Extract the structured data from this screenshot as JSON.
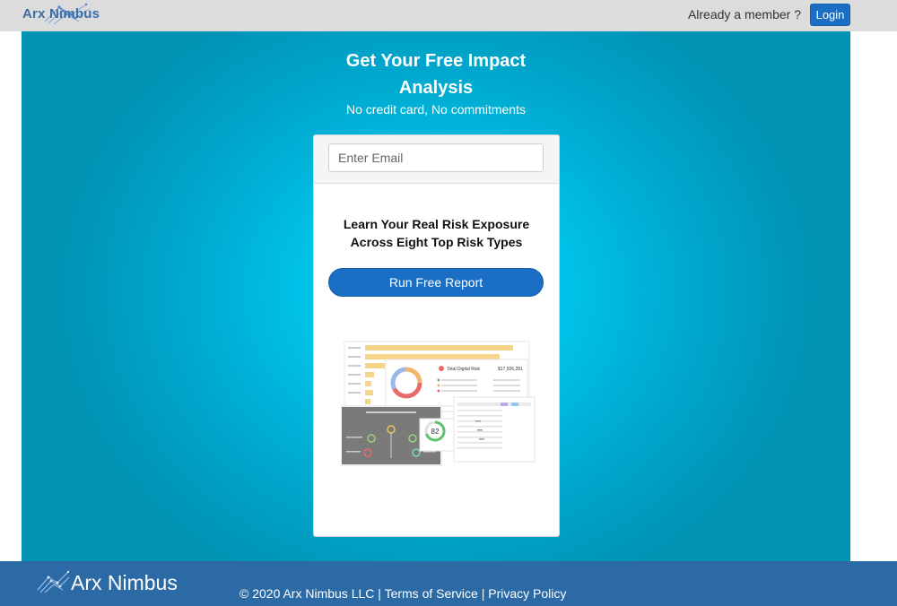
{
  "header": {
    "logo_text": "Arx Nimbus",
    "member_prompt": "Already a member ?",
    "login_label": "Login"
  },
  "hero": {
    "title_line1": "Get Your Free Impact",
    "title_line2": "Analysis",
    "subtitle": "No credit card, No commitments"
  },
  "signup_card": {
    "email_placeholder": "Enter Email",
    "email_value": "",
    "heading_line1": "Learn Your Real Risk Exposure",
    "heading_line2": "Across Eight Top Risk Types",
    "run_button_label": "Run Free Report",
    "preview_total_label": "Total Digital Risk",
    "preview_total_value": "$17,926,281",
    "preview_score": "82"
  },
  "footer": {
    "logo_text": "Arx Nimbus",
    "copyright": "© 2020 Arx Nimbus LLC",
    "separator": " | ",
    "terms_label": "Terms of Service",
    "privacy_label": "Privacy Policy"
  },
  "colors": {
    "accent": "#1a6fc4",
    "hero_center": "#00d8ff",
    "hero_edge": "#0093b4",
    "footer": "#2b6aa5",
    "topbar": "#dcdcdc"
  },
  "icons": [
    "arx-nimbus-logo-icon"
  ]
}
